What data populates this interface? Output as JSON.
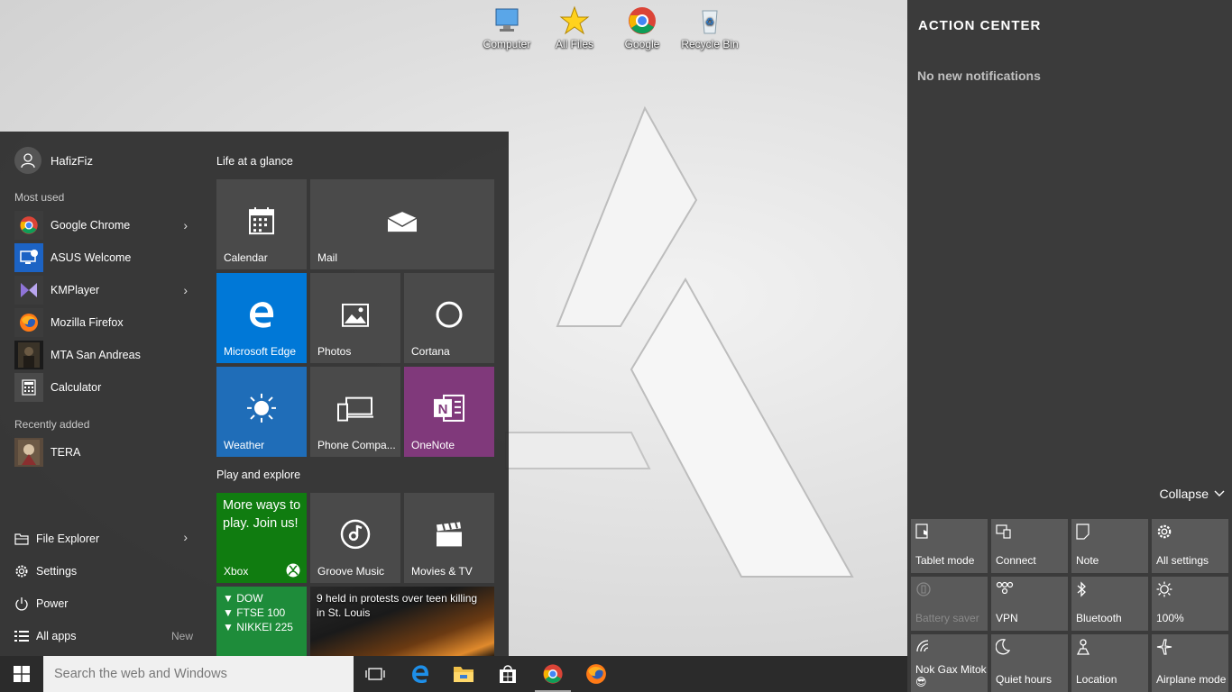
{
  "desktop": {
    "icons": [
      {
        "label": "Computer",
        "icon": "computer-icon"
      },
      {
        "label": "All Files",
        "icon": "star-icon"
      },
      {
        "label": "Google",
        "icon": "chrome-icon"
      },
      {
        "label": "Recycle Bin",
        "icon": "recycle-bin-icon"
      }
    ]
  },
  "start_menu": {
    "user_name": "HafizFiz",
    "most_used_label": "Most used",
    "most_used": [
      {
        "label": "Google Chrome",
        "icon": "chrome-icon",
        "has_submenu": true
      },
      {
        "label": "ASUS Welcome",
        "icon": "asus-welcome-icon",
        "has_submenu": false
      },
      {
        "label": "KMPlayer",
        "icon": "kmplayer-icon",
        "has_submenu": true
      },
      {
        "label": "Mozilla Firefox",
        "icon": "firefox-icon",
        "has_submenu": false
      },
      {
        "label": "MTA San Andreas",
        "icon": "mta-icon",
        "has_submenu": false
      },
      {
        "label": "Calculator",
        "icon": "calculator-icon",
        "has_submenu": false
      }
    ],
    "recently_added_label": "Recently added",
    "recently_added": [
      {
        "label": "TERA",
        "icon": "tera-icon"
      }
    ],
    "system": {
      "file_explorer": "File Explorer",
      "settings": "Settings",
      "power": "Power",
      "all_apps": "All apps",
      "new_badge": "New"
    },
    "groups": {
      "life": "Life at a glance",
      "play": "Play and explore"
    },
    "tiles": {
      "calendar": "Calendar",
      "mail": "Mail",
      "edge": "Microsoft Edge",
      "photos": "Photos",
      "cortana": "Cortana",
      "weather": "Weather",
      "phone": "Phone Compa...",
      "onenote": "OneNote",
      "xbox_promo": "More ways to play. Join us!",
      "xbox": "Xbox",
      "groove": "Groove Music",
      "movies": "Movies & TV",
      "money_lines": [
        "▼ DOW",
        "▼ FTSE 100",
        "▼ NIKKEI 225"
      ],
      "news_headline": "9 held in protests over teen killing in St. Louis"
    },
    "colors": {
      "edge_blue": "#0078d7",
      "weather_blue": "#1f6db8",
      "onenote_purple": "#80397b",
      "xbox_green": "#107c10",
      "money_green": "#1e8c3a"
    }
  },
  "action_center": {
    "title": "ACTION CENTER",
    "empty_text": "No new notifications",
    "collapse_label": "Collapse",
    "quick_actions": [
      {
        "label": "Tablet mode",
        "icon": "tablet-mode-icon",
        "dim": false
      },
      {
        "label": "Connect",
        "icon": "connect-icon",
        "dim": false
      },
      {
        "label": "Note",
        "icon": "note-icon",
        "dim": false
      },
      {
        "label": "All settings",
        "icon": "gear-icon",
        "dim": false
      },
      {
        "label": "Battery saver",
        "icon": "battery-saver-icon",
        "dim": true
      },
      {
        "label": "VPN",
        "icon": "vpn-icon",
        "dim": false
      },
      {
        "label": "Bluetooth",
        "icon": "bluetooth-icon",
        "dim": false
      },
      {
        "label": "100%",
        "icon": "brightness-icon",
        "dim": false
      },
      {
        "label": "Nok Gax Mitok 😎",
        "icon": "wifi-icon",
        "dim": false
      },
      {
        "label": "Quiet hours",
        "icon": "moon-icon",
        "dim": false
      },
      {
        "label": "Location",
        "icon": "location-icon",
        "dim": false
      },
      {
        "label": "Airplane mode",
        "icon": "airplane-icon",
        "dim": false
      }
    ]
  },
  "taskbar": {
    "search_placeholder": "Search the web and Windows",
    "pinned": [
      "task-view-icon",
      "edge-icon",
      "file-explorer-icon",
      "store-icon",
      "chrome-icon",
      "firefox-icon"
    ]
  }
}
